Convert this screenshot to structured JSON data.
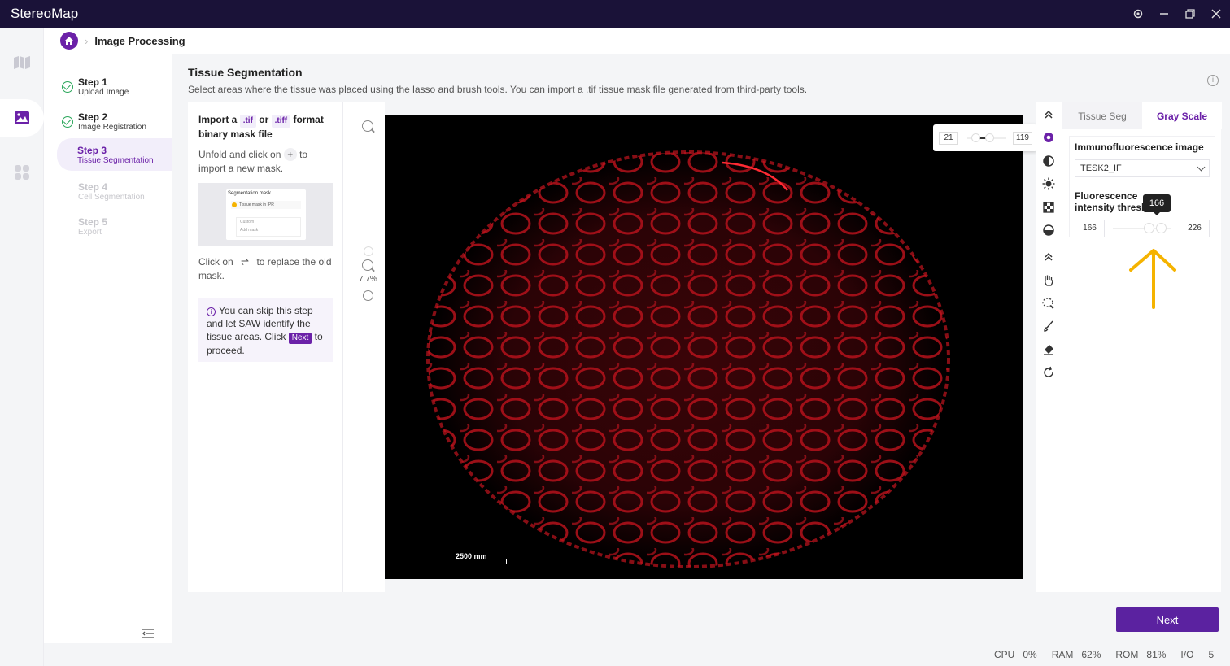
{
  "app": {
    "title": "StereoMap"
  },
  "breadcrumb": {
    "title": "Image Processing"
  },
  "steps": [
    {
      "title": "Step 1",
      "subtitle": "Upload Image",
      "state": "done"
    },
    {
      "title": "Step 2",
      "subtitle": "Image Registration",
      "state": "done"
    },
    {
      "title": "Step 3",
      "subtitle": "Tissue Segmentation",
      "state": "active"
    },
    {
      "title": "Step 4",
      "subtitle": "Cell Segmentation",
      "state": "disabled"
    },
    {
      "title": "Step 5",
      "subtitle": "Export",
      "state": "disabled"
    }
  ],
  "header": {
    "title": "Tissue Segmentation",
    "description": "Select areas where the tissue was placed using the lasso and brush tools. You can import a .tif tissue mask file generated from third-party tools."
  },
  "left_panel": {
    "import_prefix": "Import a",
    "tif": ".tif",
    "or": "or",
    "tiff": ".tiff",
    "import_suffix": "format binary mask file",
    "unfold_prefix": "Unfold and click on",
    "unfold_plus": "+",
    "unfold_suffix": "to import a new mask.",
    "preview_header": "Segmentation mask",
    "preview_row": "Tissue mask in IPR",
    "preview_custom": "Custom",
    "preview_add": "Add mask",
    "replace_prefix": "Click on",
    "replace_icon": "⇌",
    "replace_suffix": "to replace the old mask.",
    "skip_prefix": "You can skip this step and let SAW identify the tissue areas. Click",
    "skip_next": "Next",
    "skip_suffix": "to proceed."
  },
  "zoom": {
    "level": "7.7%",
    "slider_fraction": 0.0
  },
  "canvas": {
    "scalebar_label": "2500 mm"
  },
  "image_popup": {
    "min": "21",
    "max": "119"
  },
  "right_panel": {
    "tabs": [
      {
        "label": "Tissue Seg",
        "active": false
      },
      {
        "label": "Gray Scale",
        "active": true
      }
    ],
    "if_label": "Immunofluorescence image",
    "if_value": "TESK2_IF",
    "threshold_label": "Fluorescence intensity threshold",
    "threshold_min": "166",
    "threshold_max": "226",
    "tooltip": "166"
  },
  "footer": {
    "next_label": "Next"
  },
  "status": {
    "cpu_label": "CPU",
    "cpu": "0%",
    "ram_label": "RAM",
    "ram": "62%",
    "rom_label": "ROM",
    "rom": "81%",
    "io_label": "I/O",
    "io": "5"
  },
  "colors": {
    "brand": "#6b21a8",
    "titlebar": "#1a1238",
    "tissue": "#c0141e",
    "annotation": "#f5b300"
  }
}
